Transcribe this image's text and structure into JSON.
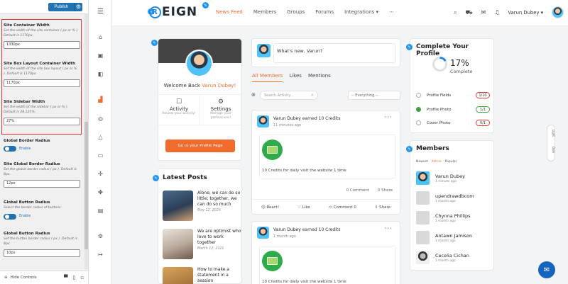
{
  "customizer": {
    "publish_label": "Publish",
    "hide_controls_label": "Hide Controls",
    "sections": [
      {
        "label": "Site Container Width",
        "desc": "Set the width of the site container ( px or % ). Default is 1170px.",
        "value": "1330px"
      },
      {
        "label": "Site Box Layout Container Width",
        "desc": "Set the width of the site box layout ( px or % ). Default is 1170px.",
        "value": "1170px"
      },
      {
        "label": "Site Sidebar Width",
        "desc": "Set the width of the sidebar ( px or % ). Default is 28.125%.",
        "value": "27%"
      },
      {
        "label": "Global Border Radius",
        "toggle_text": "Enable"
      },
      {
        "label": "Site Global Border Radius",
        "desc": "Set the global border radius ( px ). Default is 8px.",
        "value": "12px"
      },
      {
        "label": "Global Button Radius",
        "desc": "Select the border radius of buttons.",
        "toggle_text": "Enable"
      },
      {
        "label": "Global Button Radius",
        "desc": "Set the button border radius ( px ). Default is 8px.",
        "value": "10px"
      }
    ]
  },
  "header": {
    "logo_text": "EIGN",
    "logo_letter": "R",
    "nav": [
      "News Feed",
      "Members",
      "Groups",
      "Forums",
      "Integrations ▾",
      "···"
    ],
    "user_name": "Varun Dubey ▾"
  },
  "welcome": {
    "greeting": "Welcome Back",
    "name": "Varun Dubey!",
    "activity_title": "Activity",
    "activity_sub": "Review your activity!",
    "settings_title": "Settings",
    "settings_sub": "Manage your preferences!",
    "button": "Go to your Profile Page"
  },
  "latest_posts": {
    "title": "Latest Posts",
    "items": [
      {
        "title": "Alone, we can do so little; together, we can do so much",
        "date": "May 12, 2023"
      },
      {
        "title": "We are optimist who love to work together",
        "date": "March 12, 2021"
      },
      {
        "title": "How to make a statement in a session",
        "date": ""
      }
    ]
  },
  "feed": {
    "composer_placeholder": "What's new, Varun?",
    "tabs": [
      "All Members",
      "Likes",
      "Mentions"
    ],
    "search_placeholder": "Search Activity...",
    "filter_value": "-- Everything --",
    "activities": [
      {
        "author": "Varun Dubey",
        "action": "earned 10 Credits",
        "time": "11 minutes ago",
        "text": "10 Credits for daily visit the website 1 time",
        "comments": "0 Comment",
        "shares": "0 Share",
        "react": "React!",
        "like": "Like",
        "comment_btn": "Comment 0",
        "share_btn": "Share"
      },
      {
        "author": "Varun Dubey",
        "action": "earned 10 Credits",
        "time": "1 month ago",
        "text": "10 Credits for daily visit the website 1 time"
      }
    ]
  },
  "profile": {
    "title": "Complete Your Profile",
    "percent": "17%",
    "percent_sub": "Complete",
    "percent_value": 17,
    "fields": [
      {
        "label": "Profile Fields",
        "value": "1/10",
        "done": false
      },
      {
        "label": "Profile Photo",
        "value": "1/1",
        "done": true
      },
      {
        "label": "Cover Photo",
        "value": "0/1",
        "done": false
      }
    ]
  },
  "members": {
    "title": "Members",
    "tabs": [
      "Newest",
      "Active",
      "Popular"
    ],
    "list": [
      {
        "name": "Varun Dubey",
        "time": "1 minute ago"
      },
      {
        "name": "upendrawdbcom",
        "time": "1 month ago"
      },
      {
        "name": "Chynna Phillips",
        "time": "1 month ago"
      },
      {
        "name": "Antawn Jamison",
        "time": "1 month ago"
      },
      {
        "name": "Cecelia Cichan",
        "time": "1 month ago"
      }
    ]
  },
  "side_toggle": {
    "light": "Light",
    "dark": "Dark"
  },
  "colors": {
    "accent": "#f16b2c",
    "primary": "#2271b1",
    "success": "#43a047",
    "danger": "#e53935"
  }
}
